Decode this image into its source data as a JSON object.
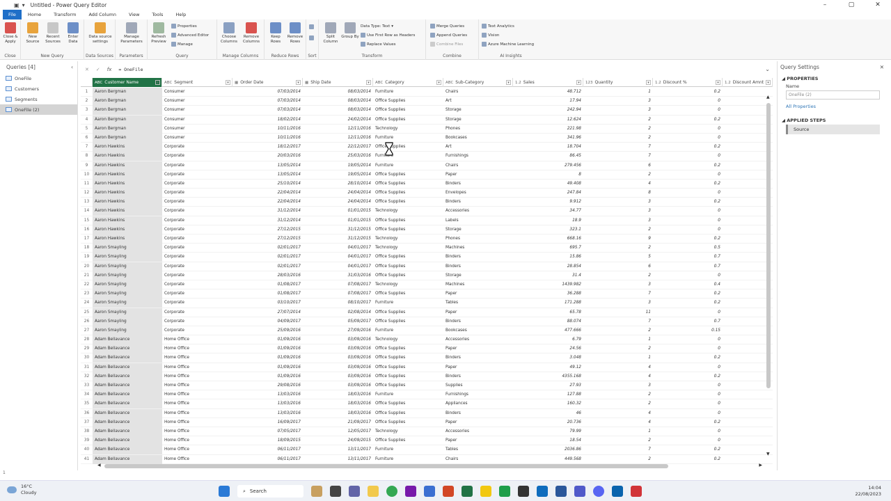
{
  "window": {
    "title": "Untitled - Power Query Editor",
    "min": "–",
    "max": "▢",
    "close": "✕"
  },
  "tabs": [
    "File",
    "Home",
    "Transform",
    "Add Column",
    "View",
    "Tools",
    "Help"
  ],
  "ribbon": {
    "close_apply": "Close & Apply",
    "new_source": "New Source",
    "recent_sources": "Recent Sources",
    "enter_data": "Enter Data",
    "data_source_settings": "Data source settings",
    "manage_parameters": "Manage Parameters",
    "refresh_preview": "Refresh Preview",
    "properties": "Properties",
    "advanced_editor": "Advanced Editor",
    "manage": "Manage",
    "choose_columns": "Choose Columns",
    "remove_columns": "Remove Columns",
    "keep_rows": "Keep Rows",
    "remove_rows": "Remove Rows",
    "split_column": "Split Column",
    "group_by": "Group By",
    "data_type": "Data Type: Text",
    "use_first_row": "Use First Row as Headers",
    "replace_values": "Replace Values",
    "merge_queries": "Merge Queries",
    "append_queries": "Append Queries",
    "combine_files": "Combine Files",
    "text_analytics": "Text Analytics",
    "vision": "Vision",
    "azure_ml": "Azure Machine Learning",
    "groups": [
      "Close",
      "New Query",
      "Data Sources",
      "Parameters",
      "Query",
      "Manage Columns",
      "Reduce Rows",
      "Sort",
      "Transform",
      "Combine",
      "AI Insights"
    ]
  },
  "queries": {
    "header": "Queries [4]",
    "collapse": "‹",
    "items": [
      "OneFile",
      "Customers",
      "Segments",
      "OneFile (2)"
    ]
  },
  "formula": {
    "cancel": "✕",
    "confirm": "✓",
    "fx": "fx",
    "text": "= OneFile",
    "expand": "⌄"
  },
  "columns": [
    {
      "type": "ABC",
      "name": "Customer Name"
    },
    {
      "type": "ABC",
      "name": "Segment"
    },
    {
      "type": "▦",
      "name": "Order Date"
    },
    {
      "type": "▦",
      "name": "Ship Date"
    },
    {
      "type": "ABC",
      "name": "Category"
    },
    {
      "type": "ABC",
      "name": "Sub-Category"
    },
    {
      "type": "1.2",
      "name": "Sales"
    },
    {
      "type": "123",
      "name": "Quantity"
    },
    {
      "type": "1.2",
      "name": "Discount %"
    },
    {
      "type": "1.2",
      "name": "Discount Amnt"
    }
  ],
  "rows": [
    [
      "1",
      "Aaron Bergman",
      "Consumer",
      "07/03/2014",
      "08/03/2014",
      "Furniture",
      "Chairs",
      "48.712",
      "1",
      "0.2"
    ],
    [
      "2",
      "Aaron Bergman",
      "Consumer",
      "07/03/2014",
      "08/03/2014",
      "Office Supplies",
      "Art",
      "17.94",
      "3",
      "0"
    ],
    [
      "3",
      "Aaron Bergman",
      "Consumer",
      "07/03/2014",
      "08/03/2014",
      "Office Supplies",
      "Storage",
      "242.94",
      "3",
      "0"
    ],
    [
      "4",
      "Aaron Bergman",
      "Consumer",
      "18/02/2014",
      "24/02/2014",
      "Office Supplies",
      "Storage",
      "12.624",
      "2",
      "0.2"
    ],
    [
      "5",
      "Aaron Bergman",
      "Consumer",
      "10/11/2016",
      "12/11/2016",
      "Technology",
      "Phones",
      "221.98",
      "2",
      "0"
    ],
    [
      "6",
      "Aaron Bergman",
      "Consumer",
      "10/11/2016",
      "12/11/2016",
      "Furniture",
      "Bookcases",
      "341.96",
      "2",
      "0"
    ],
    [
      "7",
      "Aaron Hawkins",
      "Corporate",
      "18/12/2017",
      "22/12/2017",
      "Office Supplies",
      "Art",
      "18.704",
      "7",
      "0.2"
    ],
    [
      "8",
      "Aaron Hawkins",
      "Corporate",
      "20/03/2016",
      "25/03/2016",
      "Furniture",
      "Furnishings",
      "86.45",
      "7",
      "0"
    ],
    [
      "9",
      "Aaron Hawkins",
      "Corporate",
      "13/05/2014",
      "19/05/2014",
      "Furniture",
      "Chairs",
      "279.456",
      "6",
      "0.2"
    ],
    [
      "10",
      "Aaron Hawkins",
      "Corporate",
      "13/05/2014",
      "19/05/2014",
      "Office Supplies",
      "Paper",
      "8",
      "2",
      "0"
    ],
    [
      "11",
      "Aaron Hawkins",
      "Corporate",
      "25/10/2014",
      "28/10/2014",
      "Office Supplies",
      "Binders",
      "49.408",
      "4",
      "0.2"
    ],
    [
      "12",
      "Aaron Hawkins",
      "Corporate",
      "22/04/2014",
      "24/04/2014",
      "Office Supplies",
      "Envelopes",
      "247.84",
      "8",
      "0"
    ],
    [
      "13",
      "Aaron Hawkins",
      "Corporate",
      "22/04/2014",
      "24/04/2014",
      "Office Supplies",
      "Binders",
      "9.912",
      "3",
      "0.2"
    ],
    [
      "14",
      "Aaron Hawkins",
      "Corporate",
      "31/12/2014",
      "01/01/2015",
      "Technology",
      "Accessories",
      "34.77",
      "3",
      "0"
    ],
    [
      "15",
      "Aaron Hawkins",
      "Corporate",
      "31/12/2014",
      "01/01/2015",
      "Office Supplies",
      "Labels",
      "18.9",
      "3",
      "0"
    ],
    [
      "16",
      "Aaron Hawkins",
      "Corporate",
      "27/12/2015",
      "31/12/2015",
      "Office Supplies",
      "Storage",
      "323.1",
      "2",
      "0"
    ],
    [
      "17",
      "Aaron Hawkins",
      "Corporate",
      "27/12/2015",
      "31/12/2015",
      "Technology",
      "Phones",
      "668.16",
      "9",
      "0.2"
    ],
    [
      "18",
      "Aaron Smayling",
      "Corporate",
      "02/01/2017",
      "04/01/2017",
      "Technology",
      "Machines",
      "695.7",
      "2",
      "0.5"
    ],
    [
      "19",
      "Aaron Smayling",
      "Corporate",
      "02/01/2017",
      "04/01/2017",
      "Office Supplies",
      "Binders",
      "15.86",
      "5",
      "0.7"
    ],
    [
      "20",
      "Aaron Smayling",
      "Corporate",
      "02/01/2017",
      "04/01/2017",
      "Office Supplies",
      "Binders",
      "28.854",
      "6",
      "0.7"
    ],
    [
      "21",
      "Aaron Smayling",
      "Corporate",
      "28/03/2016",
      "31/03/2016",
      "Office Supplies",
      "Storage",
      "31.4",
      "2",
      "0"
    ],
    [
      "22",
      "Aaron Smayling",
      "Corporate",
      "01/08/2017",
      "07/08/2017",
      "Technology",
      "Machines",
      "1439.982",
      "3",
      "0.4"
    ],
    [
      "23",
      "Aaron Smayling",
      "Corporate",
      "01/08/2017",
      "07/08/2017",
      "Office Supplies",
      "Paper",
      "36.288",
      "7",
      "0.2"
    ],
    [
      "24",
      "Aaron Smayling",
      "Corporate",
      "03/10/2017",
      "08/10/2017",
      "Furniture",
      "Tables",
      "171.288",
      "3",
      "0.2"
    ],
    [
      "25",
      "Aaron Smayling",
      "Corporate",
      "27/07/2014",
      "02/08/2014",
      "Office Supplies",
      "Paper",
      "65.78",
      "11",
      "0"
    ],
    [
      "26",
      "Aaron Smayling",
      "Corporate",
      "04/09/2017",
      "05/09/2017",
      "Office Supplies",
      "Binders",
      "88.074",
      "7",
      "0.7"
    ],
    [
      "27",
      "Aaron Smayling",
      "Corporate",
      "25/09/2016",
      "27/09/2016",
      "Furniture",
      "Bookcases",
      "477.666",
      "2",
      "0.15"
    ],
    [
      "28",
      "Adam Bellavance",
      "Home Office",
      "01/09/2016",
      "03/09/2016",
      "Technology",
      "Accessories",
      "6.79",
      "1",
      "0"
    ],
    [
      "29",
      "Adam Bellavance",
      "Home Office",
      "01/09/2016",
      "03/09/2016",
      "Office Supplies",
      "Paper",
      "24.56",
      "2",
      "0"
    ],
    [
      "30",
      "Adam Bellavance",
      "Home Office",
      "01/09/2016",
      "03/09/2016",
      "Office Supplies",
      "Binders",
      "3.048",
      "1",
      "0.2"
    ],
    [
      "31",
      "Adam Bellavance",
      "Home Office",
      "01/09/2016",
      "03/09/2016",
      "Office Supplies",
      "Paper",
      "49.12",
      "4",
      "0"
    ],
    [
      "32",
      "Adam Bellavance",
      "Home Office",
      "01/09/2016",
      "03/09/2016",
      "Office Supplies",
      "Binders",
      "4355.168",
      "4",
      "0.2"
    ],
    [
      "33",
      "Adam Bellavance",
      "Home Office",
      "29/08/2016",
      "03/09/2016",
      "Office Supplies",
      "Supplies",
      "27.93",
      "3",
      "0"
    ],
    [
      "34",
      "Adam Bellavance",
      "Home Office",
      "13/03/2016",
      "18/03/2016",
      "Furniture",
      "Furnishings",
      "127.88",
      "2",
      "0"
    ],
    [
      "35",
      "Adam Bellavance",
      "Home Office",
      "13/03/2016",
      "18/03/2016",
      "Office Supplies",
      "Appliances",
      "160.32",
      "2",
      "0"
    ],
    [
      "36",
      "Adam Bellavance",
      "Home Office",
      "13/03/2016",
      "18/03/2016",
      "Office Supplies",
      "Binders",
      "46",
      "4",
      "0"
    ],
    [
      "37",
      "Adam Bellavance",
      "Home Office",
      "16/09/2017",
      "21/09/2017",
      "Office Supplies",
      "Paper",
      "20.736",
      "4",
      "0.2"
    ],
    [
      "38",
      "Adam Bellavance",
      "Home Office",
      "07/05/2017",
      "12/05/2017",
      "Technology",
      "Accessories",
      "79.99",
      "1",
      "0"
    ],
    [
      "39",
      "Adam Bellavance",
      "Home Office",
      "18/09/2015",
      "24/09/2015",
      "Office Supplies",
      "Paper",
      "18.54",
      "2",
      "0"
    ],
    [
      "40",
      "Adam Bellavance",
      "Home Office",
      "06/11/2017",
      "13/11/2017",
      "Furniture",
      "Tables",
      "2036.86",
      "7",
      "0.2"
    ],
    [
      "41",
      "Adam Bellavance",
      "Home Office",
      "06/11/2017",
      "13/11/2017",
      "Furniture",
      "Chairs",
      "449.568",
      "2",
      "0.2"
    ]
  ],
  "settings": {
    "header": "Query Settings",
    "close": "✕",
    "properties": "PROPERTIES",
    "name_label": "Name",
    "name_value": "OneFile (2)",
    "all_properties": "All Properties",
    "applied_steps": "APPLIED STEPS",
    "steps": [
      "Source"
    ]
  },
  "taskbar": {
    "temp": "16°C",
    "weather": "Cloudy",
    "search": "Search",
    "time": "14:04",
    "date": "22/08/2023"
  },
  "status": "1"
}
